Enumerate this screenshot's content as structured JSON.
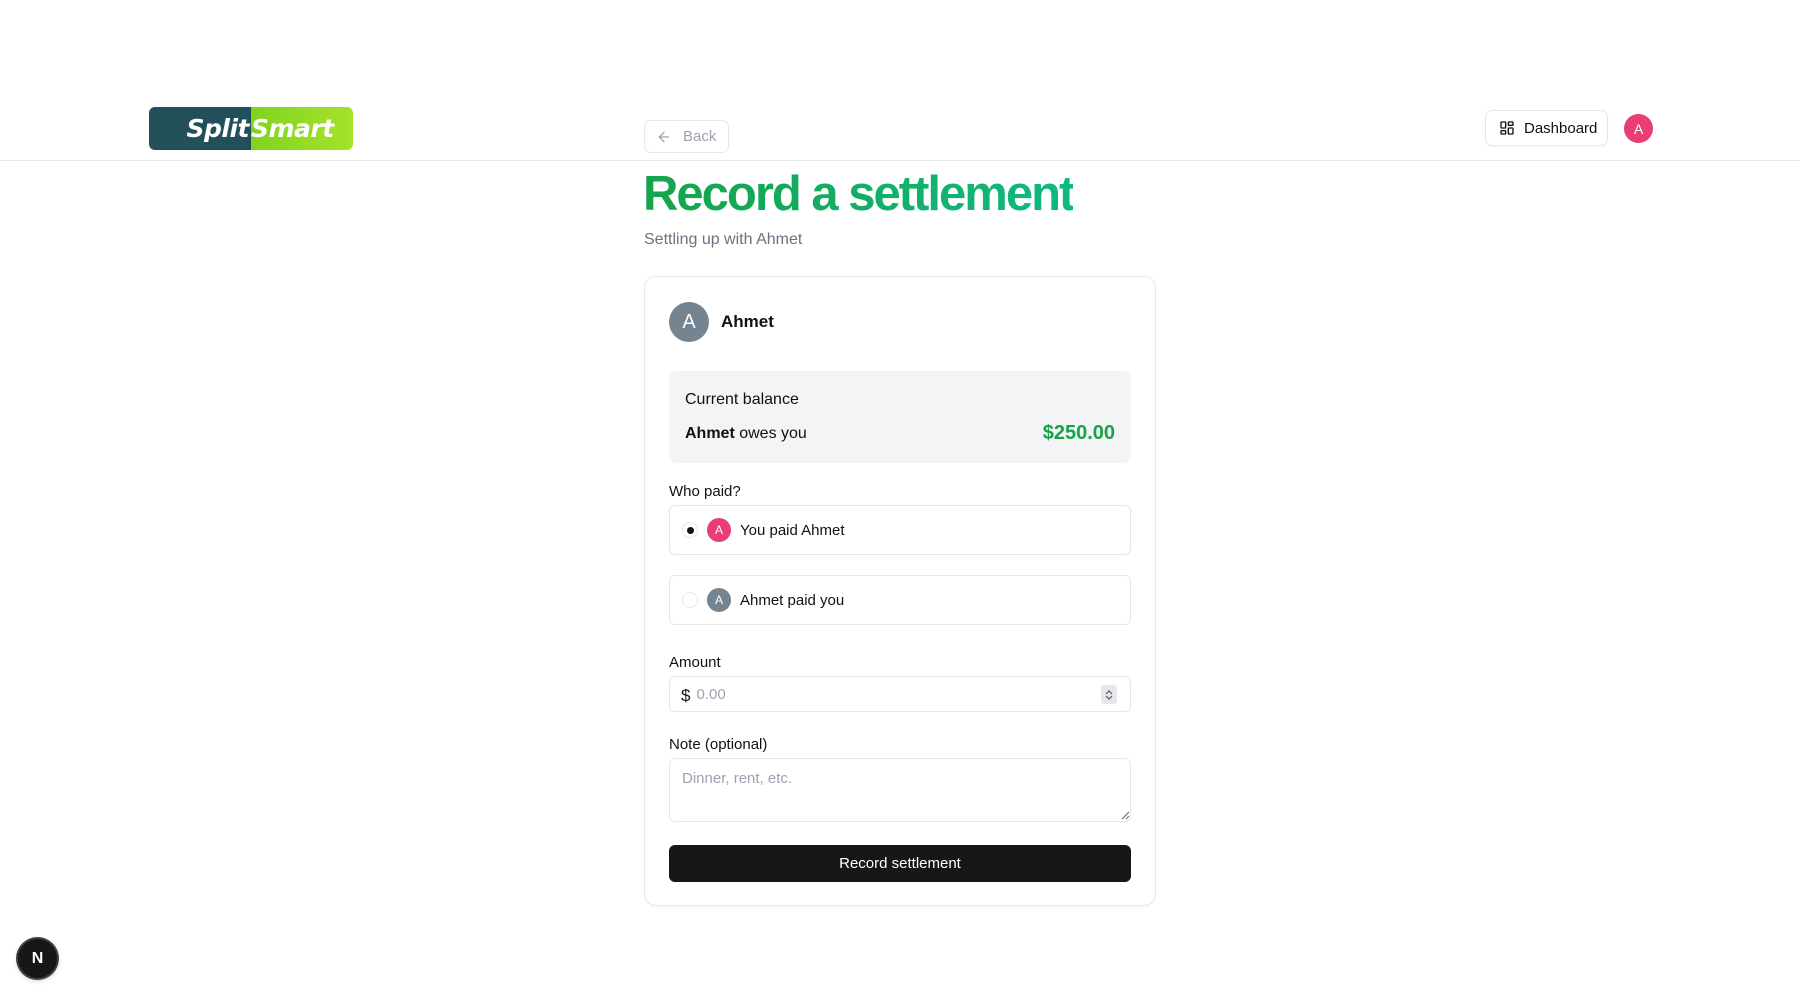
{
  "header": {
    "logo": {
      "left_text": "Split",
      "right_text": "Smart",
      "left_color": "#234f5a",
      "right_color": "#9bde26"
    },
    "back_label": "Back",
    "dashboard_label": "Dashboard",
    "user_avatar_letter": "A",
    "user_avatar_color": "#e83e74"
  },
  "page": {
    "title": "Record a settlement",
    "subtitle": "Settling up with Ahmet"
  },
  "card": {
    "person": {
      "avatar_letter": "A",
      "name": "Ahmet"
    },
    "balance": {
      "title": "Current balance",
      "debtor": "Ahmet",
      "relation": " owes you",
      "amount": "$250.00"
    },
    "who_paid": {
      "label": "Who paid?",
      "options": [
        {
          "avatar_letter": "A",
          "label": "You paid Ahmet",
          "selected": true,
          "avatar_color": "#e83e74"
        },
        {
          "avatar_letter": "A",
          "label": "Ahmet paid you",
          "selected": false,
          "avatar_color": "#748591"
        }
      ]
    },
    "amount": {
      "label": "Amount",
      "currency_symbol": "$",
      "placeholder": "0.00"
    },
    "note": {
      "label": "Note (optional)",
      "placeholder": "Dinner, rent, etc."
    },
    "submit_label": "Record settlement"
  },
  "dev_badge": {
    "letter": "N"
  },
  "colors": {
    "accent_green": "#16a34a",
    "primary_button": "#171717"
  }
}
